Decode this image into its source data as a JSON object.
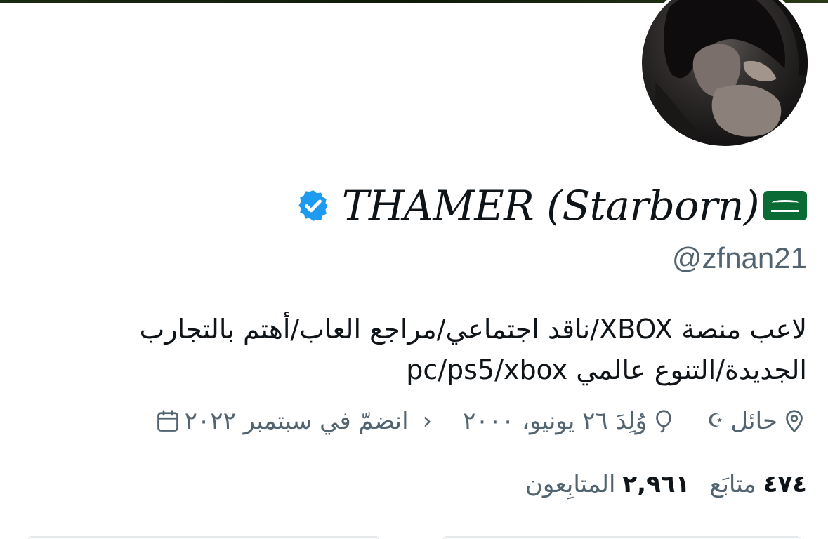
{
  "profile": {
    "display_name": "THAMER (Starborn)",
    "handle": "@zfnan21",
    "verified": true,
    "flag_icon": "saudi-flag-icon",
    "avatar_icon": "profile-photo"
  },
  "bio": {
    "line1": "لاعب منصة XBOX/ناقد اجتماعي/مراجع العاب/أهتم بالتجارب",
    "line2": "الجديدة/التنوع عالمي pc/ps5/xbox"
  },
  "meta": {
    "location": "حائل",
    "location_suffix": "☪",
    "birthday": "وُلِدَ ٢٦ يونيو، ٢٠٠٠",
    "joined": "انضمّ في سبتمبر ٢٠٢٢",
    "chevron": "›"
  },
  "stats": {
    "following_count": "٤٧٤",
    "following_label": "متابَع",
    "followers_count": "٢,٩٦١",
    "followers_label": "المتابِعون"
  },
  "colors": {
    "verified_blue": "#1d9bf0",
    "secondary_text": "#536471",
    "primary_text": "#0f1419",
    "flag_green": "#0b6b35"
  }
}
